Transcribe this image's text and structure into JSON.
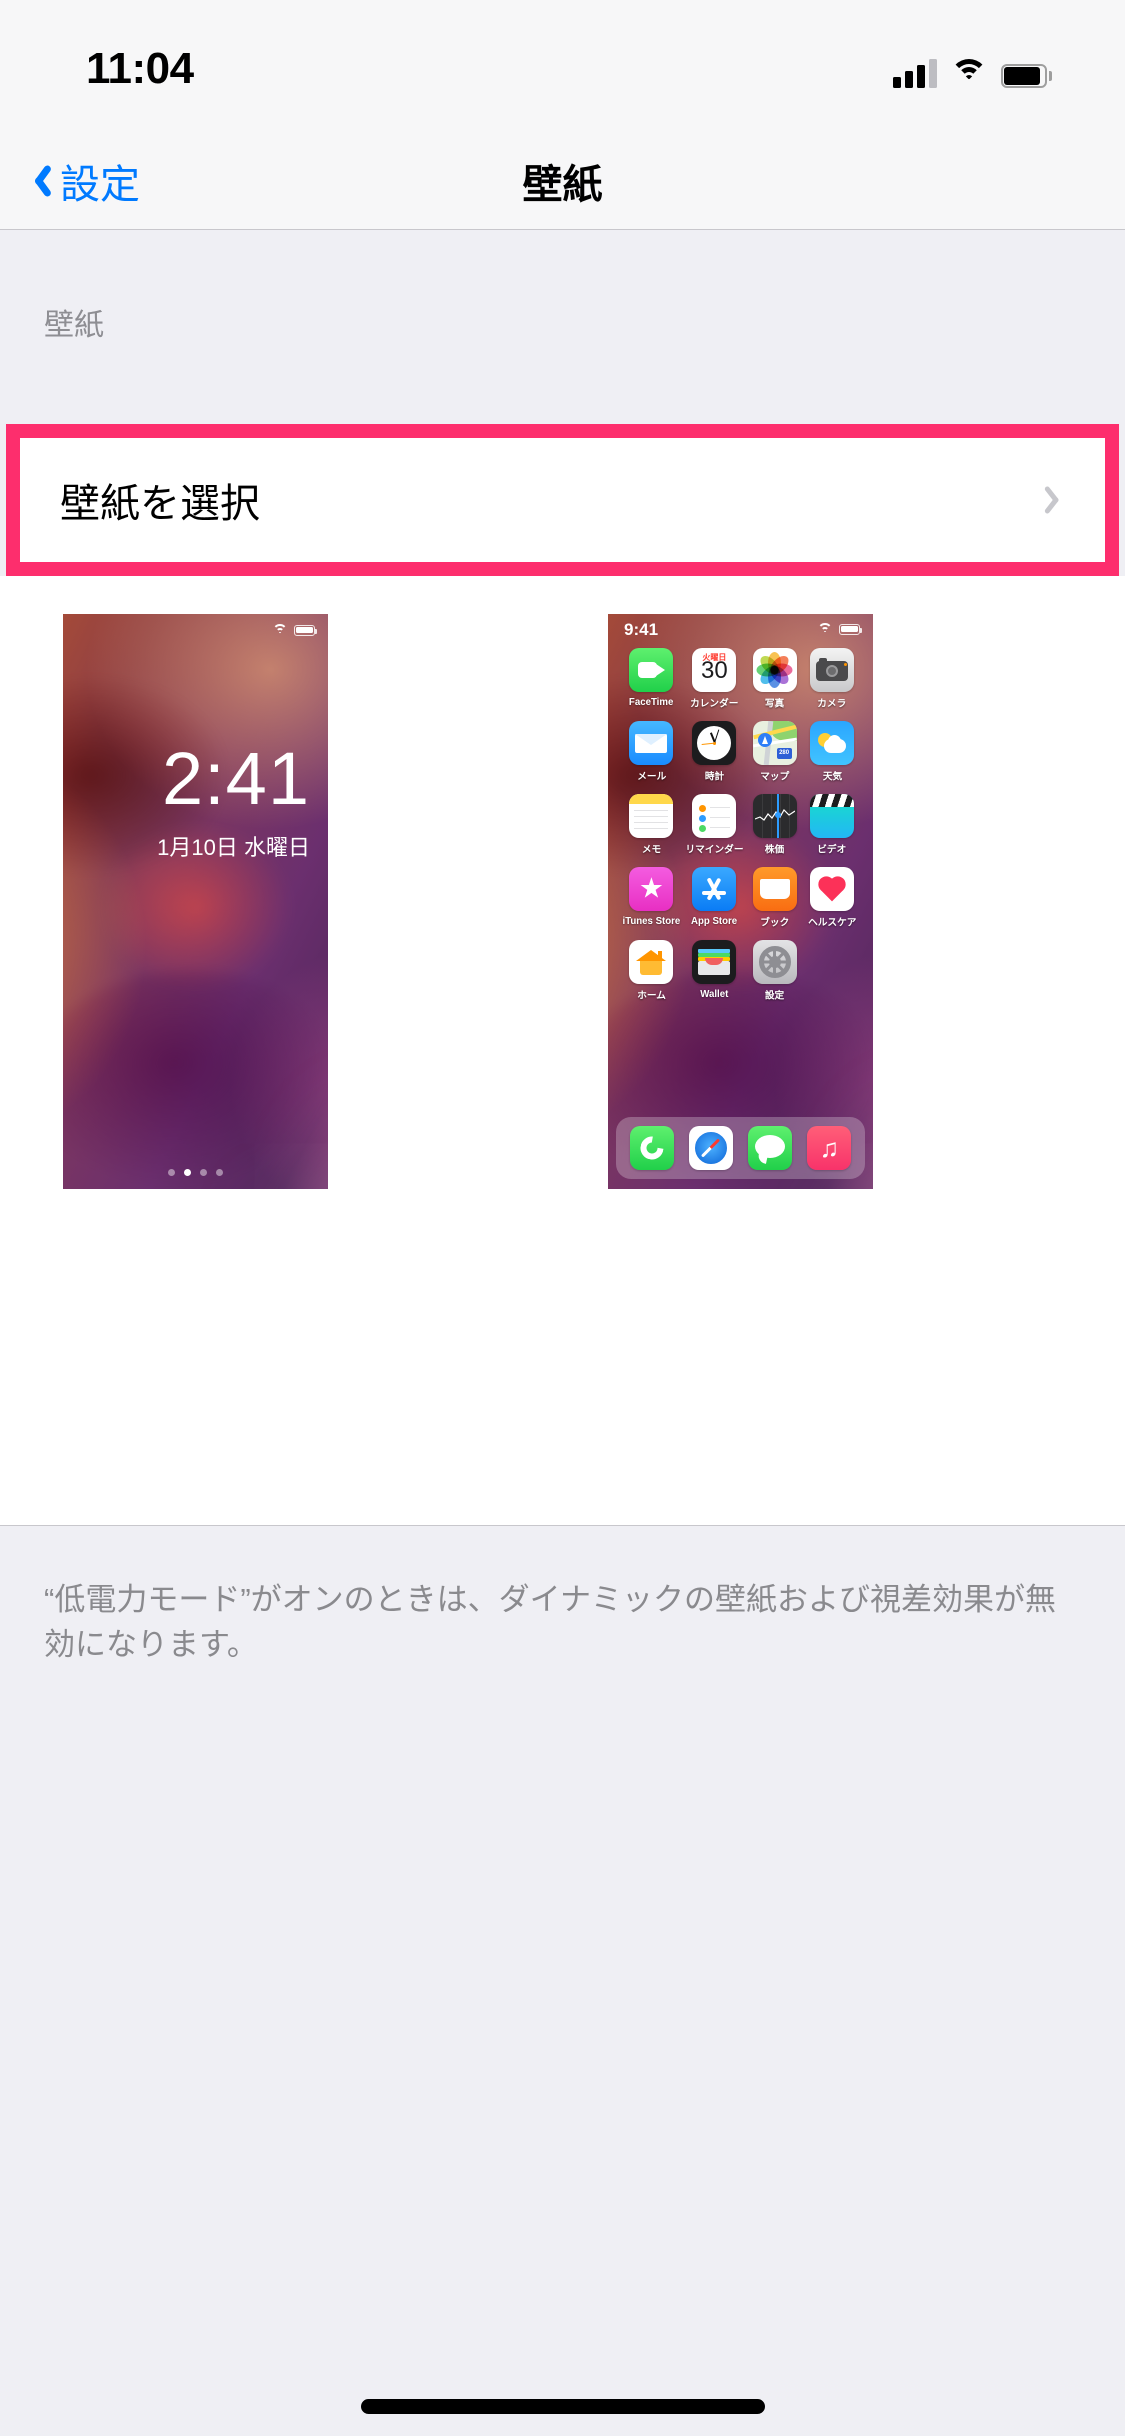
{
  "status_bar": {
    "time": "11:04",
    "signal_icon": "cellular-signal-icon",
    "wifi_icon": "wifi-icon",
    "battery_icon": "battery-icon"
  },
  "nav": {
    "back_label": "設定",
    "back_icon": "chevron-left-icon",
    "title": "壁紙"
  },
  "section": {
    "header": "壁紙"
  },
  "rows": {
    "choose_wallpaper": {
      "label": "壁紙を選択",
      "chevron_icon": "chevron-right-icon",
      "highlight_color": "#FD2E6D"
    }
  },
  "previews": {
    "lock_screen": {
      "name": "lock-screen-preview",
      "time": "2:41",
      "date": "1月10日 水曜日",
      "wifi_icon": "wifi-icon",
      "battery_icon": "battery-icon",
      "page_dots": 4,
      "active_dot": 2
    },
    "home_screen": {
      "name": "home-screen-preview",
      "time": "9:41",
      "wifi_icon": "wifi-icon",
      "battery_icon": "battery-icon",
      "apps": [
        {
          "label": "FaceTime",
          "icon": "facetime-icon"
        },
        {
          "label": "カレンダー",
          "icon": "calendar-icon",
          "dow": "火曜日",
          "day": "30"
        },
        {
          "label": "写真",
          "icon": "photos-icon"
        },
        {
          "label": "カメラ",
          "icon": "camera-icon"
        },
        {
          "label": "メール",
          "icon": "mail-icon"
        },
        {
          "label": "時計",
          "icon": "clock-icon"
        },
        {
          "label": "マップ",
          "icon": "maps-icon",
          "badge": "280"
        },
        {
          "label": "天気",
          "icon": "weather-icon"
        },
        {
          "label": "メモ",
          "icon": "notes-icon"
        },
        {
          "label": "リマインダー",
          "icon": "reminders-icon"
        },
        {
          "label": "株価",
          "icon": "stocks-icon"
        },
        {
          "label": "ビデオ",
          "icon": "videos-icon"
        },
        {
          "label": "iTunes Store",
          "icon": "itunes-store-icon"
        },
        {
          "label": "App Store",
          "icon": "app-store-icon"
        },
        {
          "label": "ブック",
          "icon": "books-icon"
        },
        {
          "label": "ヘルスケア",
          "icon": "health-icon"
        },
        {
          "label": "ホーム",
          "icon": "home-app-icon"
        },
        {
          "label": "Wallet",
          "icon": "wallet-icon"
        },
        {
          "label": "設定",
          "icon": "settings-icon"
        }
      ],
      "dock": [
        {
          "label": "電話",
          "icon": "phone-icon"
        },
        {
          "label": "Safari",
          "icon": "safari-icon"
        },
        {
          "label": "メッセージ",
          "icon": "messages-icon"
        },
        {
          "label": "ミュージック",
          "icon": "music-icon"
        }
      ]
    }
  },
  "footer": {
    "note": "“低電力モード”がオンのときは、ダイナミックの壁紙および視差効果が無効になります。"
  },
  "colors": {
    "accent_blue": "#007AFF",
    "annotation_pink": "#FD2E6D",
    "group_background": "#EFEFF4",
    "row_background": "#FFFFFF",
    "secondary_text": "#8E8E93"
  }
}
